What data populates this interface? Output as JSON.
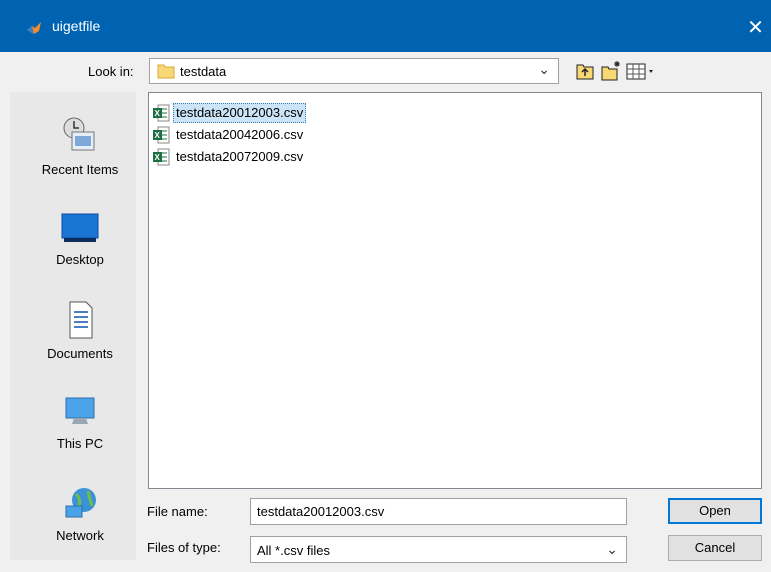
{
  "window": {
    "title": "uigetfile",
    "close_glyph": "✕",
    "app_icon": "matlab-icon"
  },
  "look_in": {
    "label": "Look in:",
    "value": "testdata",
    "folder_icon": "folder-icon"
  },
  "toolbar": {
    "icons": [
      "up-one-level-icon",
      "create-new-folder-icon",
      "view-menu-icon"
    ]
  },
  "places": [
    {
      "label": "Recent Items",
      "icon": "recent-items-icon"
    },
    {
      "label": "Desktop",
      "icon": "desktop-icon"
    },
    {
      "label": "Documents",
      "icon": "documents-icon"
    },
    {
      "label": "This PC",
      "icon": "this-pc-icon"
    },
    {
      "label": "Network",
      "icon": "network-icon"
    }
  ],
  "files": [
    {
      "name": "testdata20012003.csv",
      "selected": true,
      "icon": "excel-csv-icon"
    },
    {
      "name": "testdata20042006.csv",
      "selected": false,
      "icon": "excel-csv-icon"
    },
    {
      "name": "testdata20072009.csv",
      "selected": false,
      "icon": "excel-csv-icon"
    }
  ],
  "file_name": {
    "label": "File name:",
    "value": "testdata20012003.csv"
  },
  "file_type": {
    "label": "Files of type:",
    "value": "All *.csv files"
  },
  "buttons": {
    "open": "Open",
    "cancel": "Cancel"
  },
  "colors": {
    "titlebar": "#0063b1",
    "selection": "#cce4f7",
    "excel_green": "#1d6f42"
  }
}
